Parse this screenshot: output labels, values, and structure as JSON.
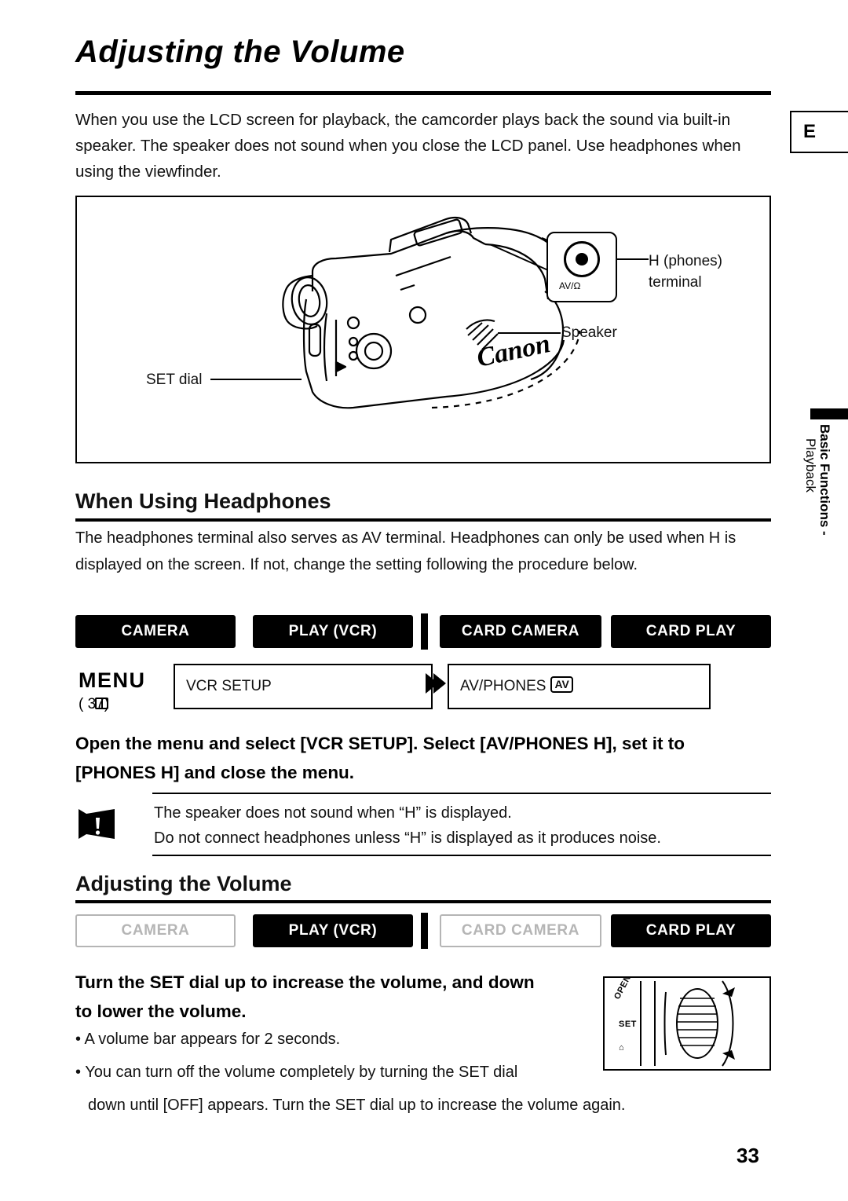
{
  "page": {
    "number": "33",
    "edge_tab": "E",
    "side_tab_line1": "Basic Functions -",
    "side_tab_line2": "Playback"
  },
  "title": "Adjusting the Volume",
  "intro": "When you use the LCD screen for playback, the camcorder plays back the sound via built-in speaker. The speaker does not sound when you close the LCD panel. Use headphones when using the viewfinder.",
  "illustration": {
    "label_phones": "H (phones)",
    "label_phones_line2": "terminal",
    "label_speaker": "Speaker",
    "label_set_dial": "SET dial",
    "jack_text": "AV/Ω",
    "brand": "Canon"
  },
  "section_headphones": {
    "heading": "When Using Headphones",
    "body": "The headphones terminal also serves as AV terminal. Headphones can only be used when    H  is displayed on the screen. If not, change the setting following the procedure below.",
    "modes": [
      {
        "label": "CAMERA",
        "style": "filled"
      },
      {
        "label": "PLAY (VCR)",
        "style": "filled"
      },
      {
        "label": "CARD CAMERA",
        "style": "filled"
      },
      {
        "label": "CARD PLAY",
        "style": "filled"
      }
    ],
    "menu": {
      "word": "MENU",
      "ref": "(        37)",
      "field1": "VCR SETUP",
      "field2": "AV/PHONES",
      "field2_badge": "AV"
    },
    "instruction_line1": "Open the menu and select [VCR SETUP]. Select [AV/PHONES H], set it to",
    "instruction_line2": "[PHONES H] and close the menu.",
    "caution_line1": "The speaker does not sound when “H” is displayed.",
    "caution_line2": "Do not connect headphones unless “H” is displayed as it produces noise."
  },
  "section_volume": {
    "heading": "Adjusting the Volume",
    "modes": [
      {
        "label": "CAMERA",
        "style": "dim"
      },
      {
        "label": "PLAY (VCR)",
        "style": "filled"
      },
      {
        "label": "CARD CAMERA",
        "style": "dim"
      },
      {
        "label": "CARD PLAY",
        "style": "filled"
      }
    ],
    "instruction_line1": "Turn the SET dial up to increase the volume, and down",
    "instruction_line2": "to lower the volume.",
    "bullets": [
      "• A volume bar appears for 2 seconds.",
      "• You can turn off the volume completely by turning the SET dial",
      "   down until [OFF] appears. Turn the SET dial up to increase the volume again."
    ],
    "dial_labels": [
      "OPEN",
      "SET",
      "⌂"
    ]
  }
}
